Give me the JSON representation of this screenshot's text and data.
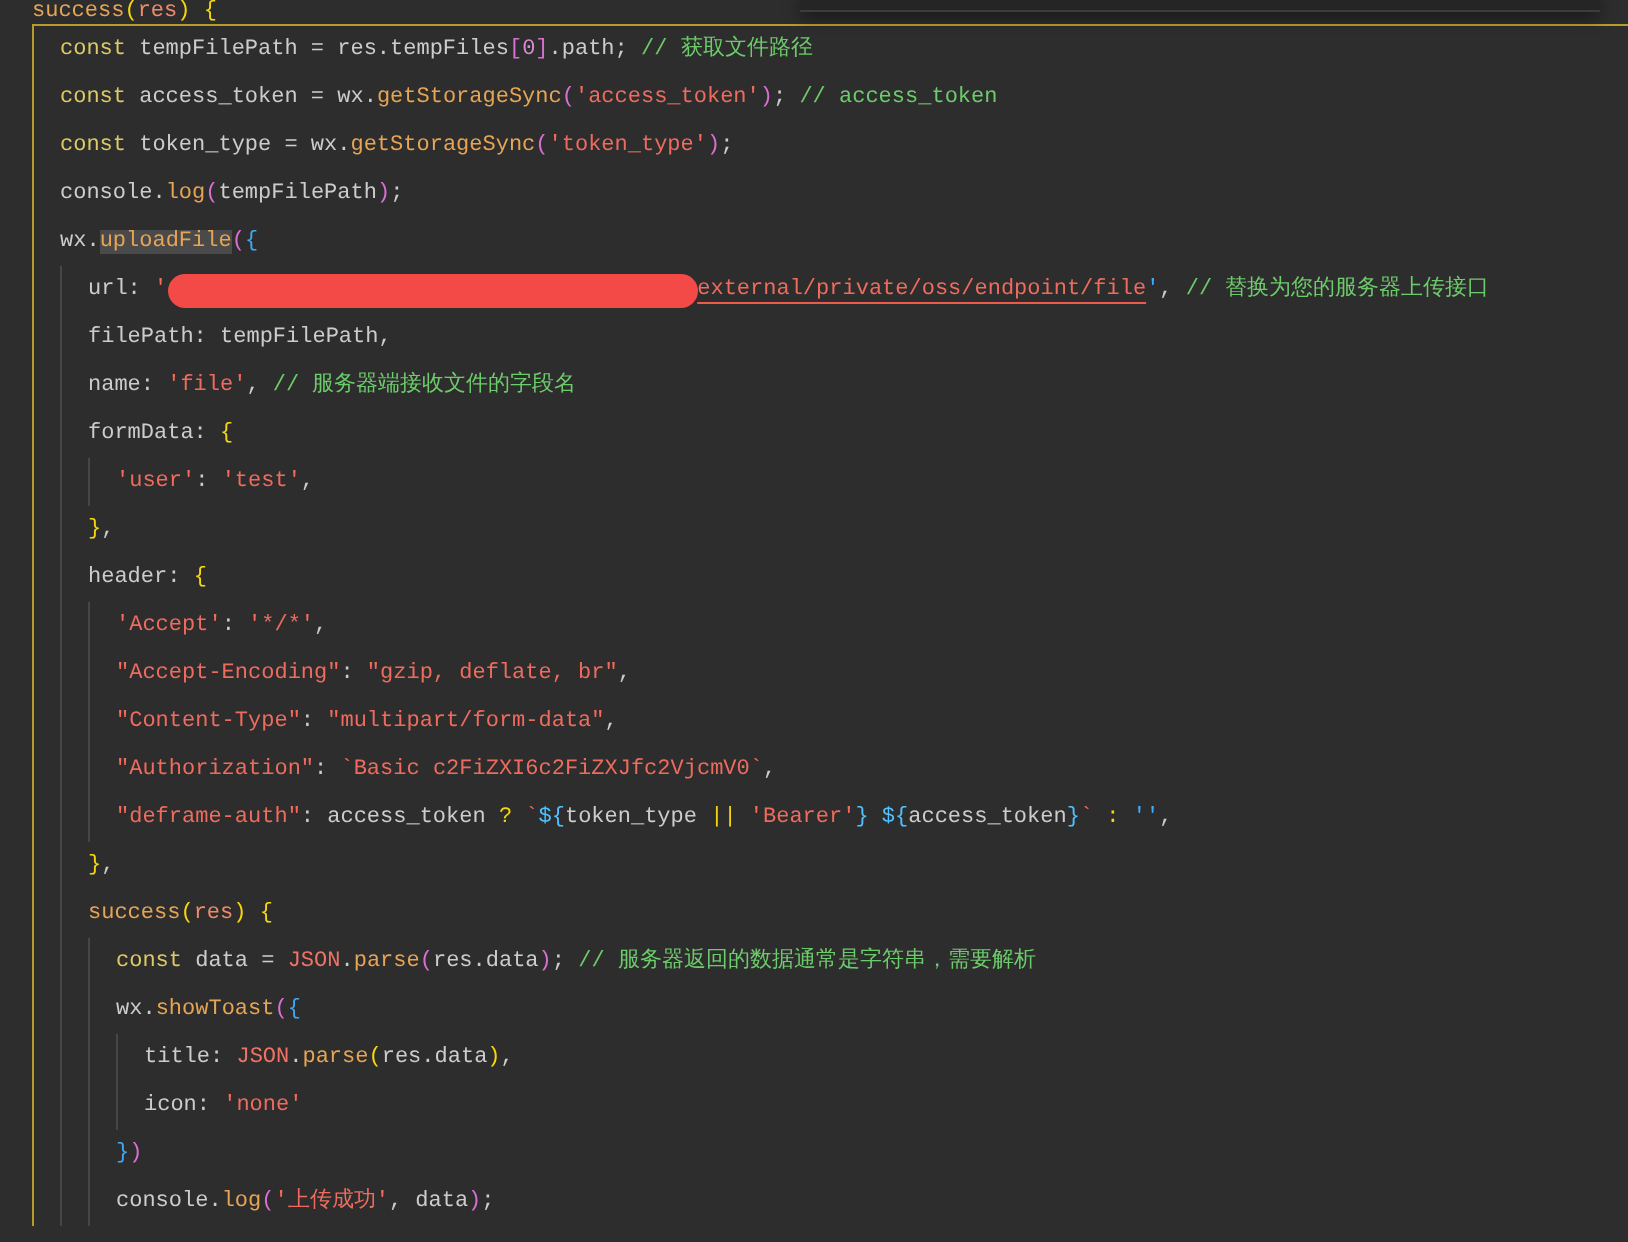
{
  "editor": {
    "lines": [
      {
        "active": true,
        "tokens": [
          {
            "kind": "fn",
            "t": "success"
          },
          {
            "kind": "b1",
            "t": "("
          },
          {
            "kind": "param",
            "t": "res"
          },
          {
            "kind": "b1",
            "t": ") "
          },
          {
            "kind": "b1",
            "t": "{"
          }
        ],
        "children": [
          {
            "tokens": [
              {
                "kind": "kw",
                "t": "const "
              },
              {
                "kind": "id",
                "t": "tempFilePath = res.tempFiles"
              },
              {
                "kind": "b2",
                "t": "["
              },
              {
                "kind": "num",
                "t": "0"
              },
              {
                "kind": "b2",
                "t": "]"
              },
              {
                "kind": "id",
                "t": ".path; "
              },
              {
                "kind": "com",
                "t": "// 获取文件路径"
              }
            ]
          },
          {
            "tokens": [
              {
                "kind": "kw",
                "t": "const "
              },
              {
                "kind": "id",
                "t": "access_token = wx."
              },
              {
                "kind": "fn",
                "t": "getStorageSync"
              },
              {
                "kind": "b2",
                "t": "("
              },
              {
                "kind": "str",
                "t": "'access_token'"
              },
              {
                "kind": "b2",
                "t": ")"
              },
              {
                "kind": "id",
                "t": "; "
              },
              {
                "kind": "com",
                "t": "// access_token"
              }
            ]
          },
          {
            "tokens": [
              {
                "kind": "kw",
                "t": "const "
              },
              {
                "kind": "id",
                "t": "token_type = wx."
              },
              {
                "kind": "fn",
                "t": "getStorageSync"
              },
              {
                "kind": "b2",
                "t": "("
              },
              {
                "kind": "str",
                "t": "'token_type'"
              },
              {
                "kind": "b2",
                "t": ")"
              },
              {
                "kind": "id",
                "t": ";"
              }
            ]
          },
          {
            "tokens": [
              {
                "kind": "id",
                "t": "console."
              },
              {
                "kind": "fn",
                "t": "log"
              },
              {
                "kind": "b2",
                "t": "("
              },
              {
                "kind": "id",
                "t": "tempFilePath"
              },
              {
                "kind": "b2",
                "t": ")"
              },
              {
                "kind": "id",
                "t": ";"
              }
            ]
          },
          {
            "active": false,
            "tokens": [
              {
                "kind": "id",
                "t": "wx."
              },
              {
                "kind": "match",
                "t": "uploadFile"
              },
              {
                "kind": "b2",
                "t": "("
              },
              {
                "kind": "b3",
                "t": "{"
              }
            ],
            "children": [
              {
                "tokens": [
                  {
                    "kind": "id",
                    "t": "url: "
                  },
                  {
                    "kind": "str",
                    "t": "'"
                  },
                  {
                    "kind": "redacted"
                  },
                  {
                    "kind": "link",
                    "t": "external/private/oss/endpoint/file"
                  },
                  {
                    "kind": "b3",
                    "t": "'"
                  },
                  {
                    "kind": "id",
                    "t": ", "
                  },
                  {
                    "kind": "com",
                    "t": "// 替换为您的服务器上传接口"
                  }
                ]
              },
              {
                "tokens": [
                  {
                    "kind": "id",
                    "t": "filePath: tempFilePath,"
                  }
                ]
              },
              {
                "tokens": [
                  {
                    "kind": "id",
                    "t": "name: "
                  },
                  {
                    "kind": "str",
                    "t": "'file'"
                  },
                  {
                    "kind": "id",
                    "t": ", "
                  },
                  {
                    "kind": "com",
                    "t": "// 服务器端接收文件的字段名"
                  }
                ]
              },
              {
                "active": false,
                "tokens": [
                  {
                    "kind": "id",
                    "t": "formData: "
                  },
                  {
                    "kind": "b1",
                    "t": "{"
                  }
                ],
                "children": [
                  {
                    "tokens": [
                      {
                        "kind": "str",
                        "t": "'user'"
                      },
                      {
                        "kind": "id",
                        "t": ": "
                      },
                      {
                        "kind": "str",
                        "t": "'test'"
                      },
                      {
                        "kind": "id",
                        "t": ","
                      }
                    ]
                  }
                ]
              },
              {
                "tokens": [
                  {
                    "kind": "b1",
                    "t": "}"
                  },
                  {
                    "kind": "id",
                    "t": ","
                  }
                ]
              },
              {
                "active": false,
                "tokens": [
                  {
                    "kind": "id",
                    "t": "header: "
                  },
                  {
                    "kind": "b1",
                    "t": "{"
                  }
                ],
                "children": [
                  {
                    "tokens": [
                      {
                        "kind": "str",
                        "t": "'Accept'"
                      },
                      {
                        "kind": "id",
                        "t": ": "
                      },
                      {
                        "kind": "str",
                        "t": "'*/*'"
                      },
                      {
                        "kind": "id",
                        "t": ","
                      }
                    ]
                  },
                  {
                    "tokens": [
                      {
                        "kind": "str",
                        "t": "\"Accept-Encoding\""
                      },
                      {
                        "kind": "id",
                        "t": ": "
                      },
                      {
                        "kind": "str",
                        "t": "\"gzip, deflate, br\""
                      },
                      {
                        "kind": "id",
                        "t": ","
                      }
                    ]
                  },
                  {
                    "tokens": [
                      {
                        "kind": "str",
                        "t": "\"Content-Type\""
                      },
                      {
                        "kind": "id",
                        "t": ": "
                      },
                      {
                        "kind": "str",
                        "t": "\"multipart/form-data\""
                      },
                      {
                        "kind": "id",
                        "t": ","
                      }
                    ]
                  },
                  {
                    "tokens": [
                      {
                        "kind": "str",
                        "t": "\"Authorization\""
                      },
                      {
                        "kind": "id",
                        "t": ": "
                      },
                      {
                        "kind": "str",
                        "t": "`Basic c2FiZXI6c2FiZXJfc2VjcmV0`"
                      },
                      {
                        "kind": "id",
                        "t": ","
                      }
                    ]
                  },
                  {
                    "tokens": [
                      {
                        "kind": "str",
                        "t": "\"deframe-auth\""
                      },
                      {
                        "kind": "id",
                        "t": ": access_token "
                      },
                      {
                        "kind": "op",
                        "t": "? "
                      },
                      {
                        "kind": "str",
                        "t": "`"
                      },
                      {
                        "kind": "tpl",
                        "t": "${"
                      },
                      {
                        "kind": "id",
                        "t": "token_type "
                      },
                      {
                        "kind": "op",
                        "t": "|| "
                      },
                      {
                        "kind": "str",
                        "t": "'Bearer'"
                      },
                      {
                        "kind": "tpl",
                        "t": "} ${"
                      },
                      {
                        "kind": "id",
                        "t": "access_token"
                      },
                      {
                        "kind": "tpl",
                        "t": "}"
                      },
                      {
                        "kind": "str",
                        "t": "` "
                      },
                      {
                        "kind": "op",
                        "t": ": "
                      },
                      {
                        "kind": "b3",
                        "t": "''"
                      },
                      {
                        "kind": "id",
                        "t": ","
                      }
                    ]
                  }
                ]
              },
              {
                "tokens": [
                  {
                    "kind": "b1",
                    "t": "}"
                  },
                  {
                    "kind": "id",
                    "t": ","
                  }
                ]
              },
              {
                "active": false,
                "tokens": [
                  {
                    "kind": "fn",
                    "t": "success"
                  },
                  {
                    "kind": "b1",
                    "t": "("
                  },
                  {
                    "kind": "param",
                    "t": "res"
                  },
                  {
                    "kind": "b1",
                    "t": ") "
                  },
                  {
                    "kind": "b1",
                    "t": "{"
                  }
                ],
                "children": [
                  {
                    "tokens": [
                      {
                        "kind": "kw",
                        "t": "const "
                      },
                      {
                        "kind": "id",
                        "t": "data = "
                      },
                      {
                        "kind": "cls",
                        "t": "JSON"
                      },
                      {
                        "kind": "id",
                        "t": "."
                      },
                      {
                        "kind": "fn",
                        "t": "parse"
                      },
                      {
                        "kind": "b2",
                        "t": "("
                      },
                      {
                        "kind": "id",
                        "t": "res.data"
                      },
                      {
                        "kind": "b2",
                        "t": ")"
                      },
                      {
                        "kind": "id",
                        "t": "; "
                      },
                      {
                        "kind": "com",
                        "t": "// 服务器返回的数据通常是字符串，需要解析"
                      }
                    ]
                  },
                  {
                    "active": false,
                    "tokens": [
                      {
                        "kind": "id",
                        "t": "wx."
                      },
                      {
                        "kind": "fn",
                        "t": "showToast"
                      },
                      {
                        "kind": "b2",
                        "t": "("
                      },
                      {
                        "kind": "b3",
                        "t": "{"
                      }
                    ],
                    "children": [
                      {
                        "tokens": [
                          {
                            "kind": "id",
                            "t": "title: "
                          },
                          {
                            "kind": "cls",
                            "t": "JSON"
                          },
                          {
                            "kind": "id",
                            "t": "."
                          },
                          {
                            "kind": "fn",
                            "t": "parse"
                          },
                          {
                            "kind": "b1",
                            "t": "("
                          },
                          {
                            "kind": "id",
                            "t": "res.data"
                          },
                          {
                            "kind": "b1",
                            "t": ")"
                          },
                          {
                            "kind": "id",
                            "t": ","
                          }
                        ]
                      },
                      {
                        "tokens": [
                          {
                            "kind": "id",
                            "t": "icon: "
                          },
                          {
                            "kind": "str",
                            "t": "'none'"
                          }
                        ]
                      }
                    ]
                  },
                  {
                    "tokens": [
                      {
                        "kind": "b3",
                        "t": "}"
                      },
                      {
                        "kind": "b2",
                        "t": ")"
                      }
                    ]
                  },
                  {
                    "tokens": [
                      {
                        "kind": "id",
                        "t": "console."
                      },
                      {
                        "kind": "fn",
                        "t": "log"
                      },
                      {
                        "kind": "b2",
                        "t": "("
                      },
                      {
                        "kind": "str",
                        "t": "'上传成功'"
                      },
                      {
                        "kind": "id",
                        "t": ", data"
                      },
                      {
                        "kind": "b2",
                        "t": ")"
                      },
                      {
                        "kind": "id",
                        "t": ";"
                      }
                    ]
                  }
                ]
              }
            ]
          }
        ]
      }
    ]
  }
}
